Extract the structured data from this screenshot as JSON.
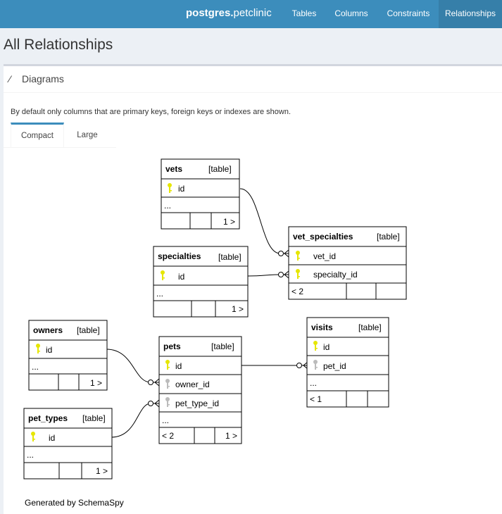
{
  "nav": {
    "brand_bold": "postgres.",
    "brand_light": "petclinic",
    "items": [
      "Tables",
      "Columns",
      "Constraints",
      "Relationships"
    ]
  },
  "page_title": "All Relationships",
  "box": {
    "title": "Diagrams",
    "note": "By default only columns that are primary keys, foreign keys or indexes are shown.",
    "tabs": [
      "Compact",
      "Large"
    ]
  },
  "tables": {
    "vets": {
      "name": "vets",
      "kind": "[table]",
      "cols": [
        "id"
      ],
      "more": "...",
      "footer_right": "1 >"
    },
    "vet_specialties": {
      "name": "vet_specialties",
      "kind": "[table]",
      "cols": [
        "vet_id",
        "specialty_id"
      ],
      "footer_left": "< 2"
    },
    "specialties": {
      "name": "specialties",
      "kind": "[table]",
      "cols": [
        "id"
      ],
      "more": "...",
      "footer_right": "1 >"
    },
    "owners": {
      "name": "owners",
      "kind": "[table]",
      "cols": [
        "id"
      ],
      "more": "...",
      "footer_right": "1 >"
    },
    "pets": {
      "name": "pets",
      "kind": "[table]",
      "cols": [
        "id",
        "owner_id",
        "pet_type_id"
      ],
      "more": "...",
      "footer_left": "< 2",
      "footer_right": "1 >"
    },
    "visits": {
      "name": "visits",
      "kind": "[table]",
      "cols": [
        "id",
        "pet_id"
      ],
      "more": "...",
      "footer_left": "< 1"
    },
    "pet_types": {
      "name": "pet_types",
      "kind": "[table]",
      "cols": [
        "id"
      ],
      "more": "...",
      "footer_right": "1 >"
    }
  },
  "footer": "Generated by SchemaSpy",
  "colors": {
    "header": "#3c8dbc",
    "active_nav": "#367fa9",
    "key_primary": "#e6e600",
    "key_foreign": "#bbbbbb"
  }
}
